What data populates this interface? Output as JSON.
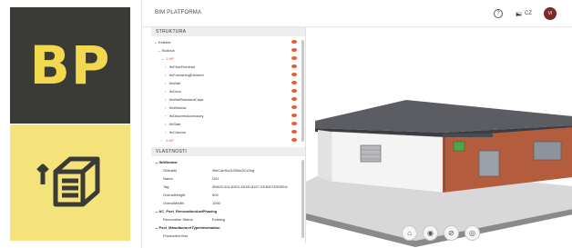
{
  "logo": {
    "text": "BP"
  },
  "app": {
    "title": "BIM PLATFORMA"
  },
  "header": {
    "help_icon": "question-circle-icon",
    "language": "CZ",
    "avatar_initials": "VI"
  },
  "structure": {
    "title": "STRUKTURA",
    "items": [
      {
        "label": "Exteriér",
        "level": 0,
        "expanded": true,
        "highlight": false
      },
      {
        "label": "Budova",
        "level": 1,
        "expanded": true,
        "highlight": false
      },
      {
        "label": "1.NP",
        "level": 2,
        "expanded": true,
        "highlight": true
      },
      {
        "label": "IfcFlowTerminal",
        "level": 3,
        "expanded": false,
        "highlight": false
      },
      {
        "label": "IfcFurnishingElement",
        "level": 3,
        "expanded": false,
        "highlight": false
      },
      {
        "label": "IfcWall",
        "level": 3,
        "expanded": false,
        "highlight": false
      },
      {
        "label": "IfcDoor",
        "level": 3,
        "expanded": false,
        "highlight": false
      },
      {
        "label": "IfcWallStandardCase",
        "level": 3,
        "expanded": false,
        "highlight": false
      },
      {
        "label": "IfcWindow",
        "level": 3,
        "expanded": false,
        "highlight": false
      },
      {
        "label": "IfcDiscreteAccessory",
        "level": 3,
        "expanded": false,
        "highlight": false
      },
      {
        "label": "IfcSlab",
        "level": 3,
        "expanded": false,
        "highlight": false
      },
      {
        "label": "IfcColumn",
        "level": 3,
        "expanded": false,
        "highlight": false
      },
      {
        "label": "2.NP",
        "level": 2,
        "expanded": false,
        "highlight": true
      }
    ]
  },
  "properties": {
    "title": "VLASTNOSTI",
    "group1": "IfcWindow",
    "rows1": [
      {
        "key": "GlobalId",
        "value": "0lleCabScrDJ05m3Cv2bg"
      },
      {
        "key": "Name",
        "value": "O01"
      },
      {
        "key": "Tag",
        "value": "0BA0C414-81E0-4D4D-8167-ED8321E50EEA"
      },
      {
        "key": "OverallHeight",
        "value": "500"
      },
      {
        "key": "OverallWidth",
        "value": "1000"
      }
    ],
    "group2": "AC_Pset_RenovationAndPhasing",
    "rows2": [
      {
        "key": "Renovation Status",
        "value": "Existing"
      }
    ],
    "group3": "Pset_ManufacturerTypeInformation",
    "rows3": [
      {
        "key": "ProductionYear",
        "value": ""
      }
    ]
  },
  "viewer_tools": [
    "home-icon",
    "eye-icon",
    "eye-off-icon",
    "target-icon"
  ],
  "colors": {
    "accent": "#e2572a",
    "eye": "#ec5a2a",
    "logo_dark": "#3a3a37",
    "logo_yellow": "#f2d84e",
    "brick": "#b45d3e"
  }
}
